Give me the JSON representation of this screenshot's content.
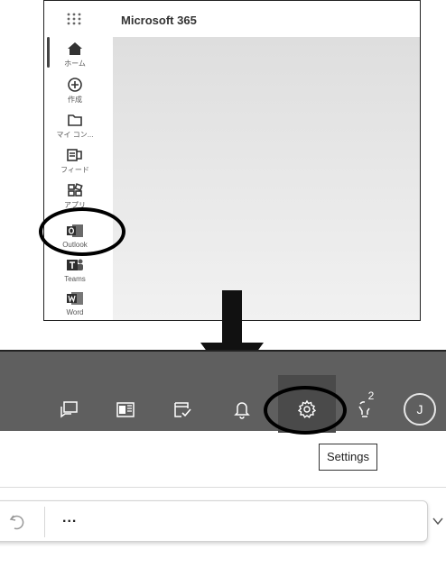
{
  "m365": {
    "title": "Microsoft 365",
    "rail": [
      {
        "label": "ホーム",
        "icon": "home-icon"
      },
      {
        "label": "作成",
        "icon": "create-plus-icon"
      },
      {
        "label": "マイ コン...",
        "icon": "folder-icon"
      },
      {
        "label": "フィード",
        "icon": "feed-icon"
      },
      {
        "label": "アプリ",
        "icon": "apps-icon"
      },
      {
        "label": "Outlook",
        "icon": "outlook-icon"
      },
      {
        "label": "Teams",
        "icon": "teams-icon"
      },
      {
        "label": "Word",
        "icon": "word-icon"
      }
    ]
  },
  "outlook": {
    "toolbar_icons": [
      "feedback-icon",
      "my-day-icon",
      "tasks-icon",
      "bell-icon",
      "settings-icon",
      "tips-lightbulb-icon"
    ],
    "tips_badge": "2",
    "avatar_initial": "J",
    "settings_tooltip": "Settings",
    "more_label": "...",
    "toolbar_color": "#5f5f5f"
  }
}
